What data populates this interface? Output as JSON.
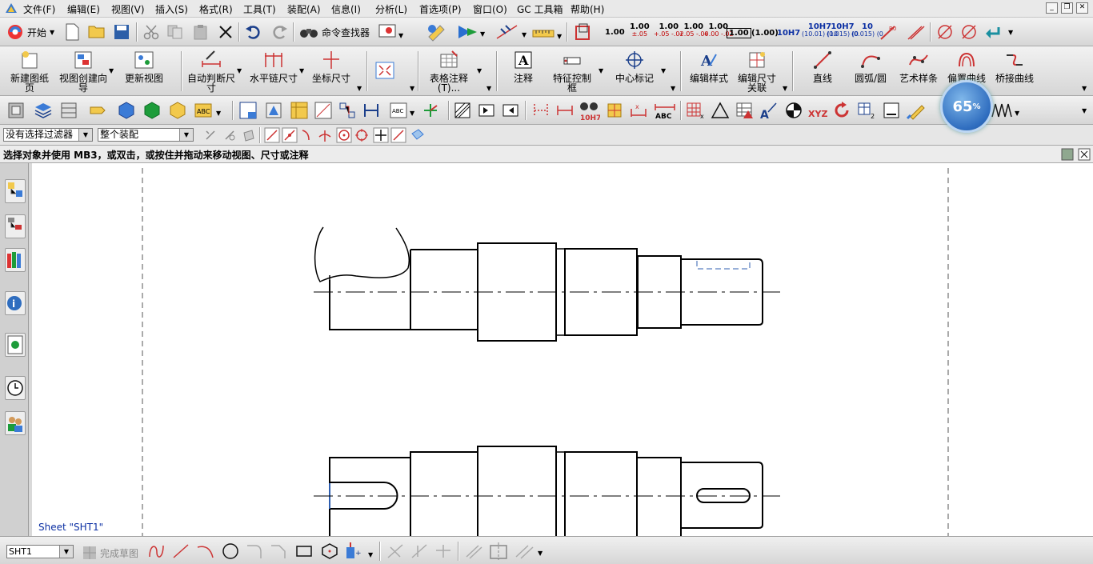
{
  "menubar": {
    "items": [
      "文件(F)",
      "编辑(E)",
      "视图(V)",
      "插入(S)",
      "格式(R)",
      "工具(T)",
      "装配(A)",
      "信息(I)",
      "分析(L)",
      "首选项(P)",
      "窗口(O)",
      "GC 工具箱",
      "帮助(H)"
    ]
  },
  "toolbar1": {
    "start_label": "开始",
    "cmd_finder_label": "命令查找器",
    "tolerances": [
      {
        "main": "1.00",
        "sub": ""
      },
      {
        "main": "1.00",
        "sub": "±.05"
      },
      {
        "main": "1.00",
        "sub": "+.05 -.02"
      },
      {
        "main": "1.00",
        "sub": "+.05 -.00"
      },
      {
        "main": "1.00",
        "sub": "+.00 -.02"
      },
      {
        "main": "1.00",
        "sub": ""
      },
      {
        "main": "(1.00)",
        "sub": ""
      },
      {
        "main": "10H7",
        "sub": ""
      },
      {
        "main": "10H7",
        "sub": "(10.01) (10"
      },
      {
        "main": "10H7",
        "sub": "(0.015) (0"
      },
      {
        "main": "10",
        "sub": "(0.015) (0"
      }
    ]
  },
  "toolbar2": {
    "buttons": [
      "新建图纸页",
      "视图创建向导",
      "更新视图",
      "自动判断尺寸",
      "水平链尺寸",
      "坐标尺寸",
      "表格注释(T)...",
      "注释",
      "特征控制框",
      "中心标记",
      "编辑样式",
      "编辑尺寸关联",
      "直线",
      "圆弧/圆",
      "艺术样条",
      "偏置曲线",
      "桥接曲线"
    ]
  },
  "filterbar": {
    "filter_value": "没有选择过滤器",
    "scope_value": "整个装配"
  },
  "status": {
    "prompt": "选择对象并使用 MB3，或双击，或按住并拖动来移动视图、尺寸或注释"
  },
  "widget": {
    "value": "65",
    "unit": "%"
  },
  "canvas": {
    "sheet_label": "Sheet \"SHT1\""
  },
  "bottombar": {
    "sheet_value": "SHT1",
    "finish_sketch_label": "完成草图"
  },
  "colors": {
    "canvas_bg": "#ffffff",
    "drawing_line": "#000000",
    "hidden_line": "#2f5fb0",
    "sheet_label": "#0b2fa3"
  }
}
